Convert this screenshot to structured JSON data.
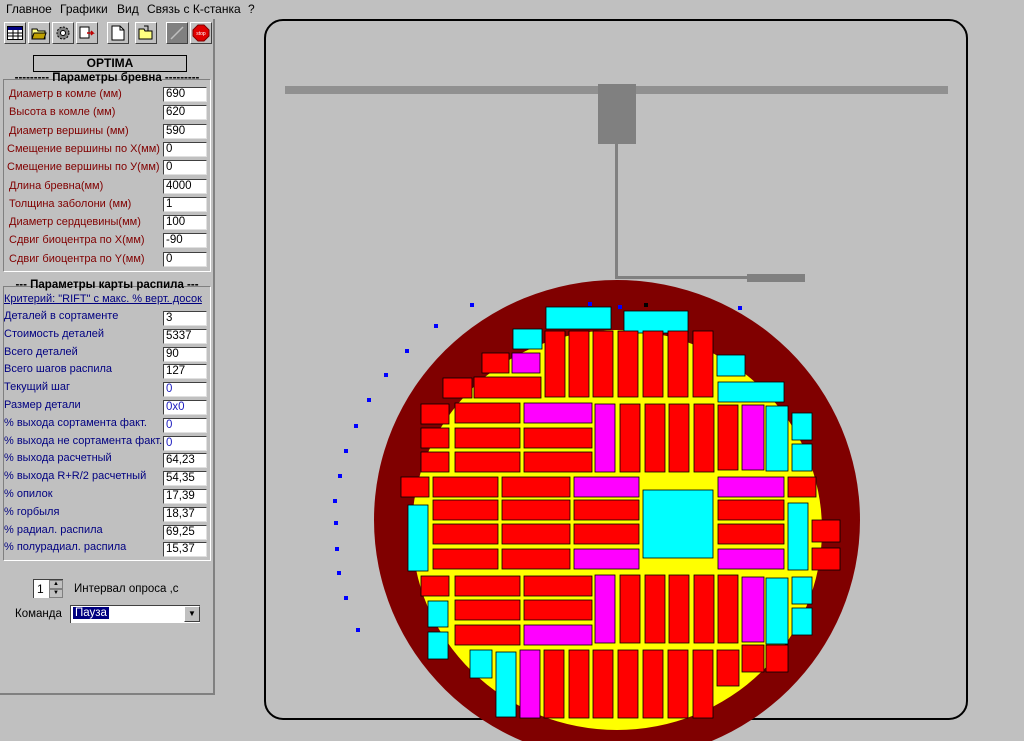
{
  "menu": [
    "Главное",
    "Графики",
    "Вид",
    "Связь с К-станка",
    "?"
  ],
  "toolbar": {
    "icons": [
      "table-icon",
      "open-folder-icon",
      "gear-icon",
      "export-icon",
      "new-file-icon",
      "open-file-icon",
      "line-tool-icon",
      "stop-icon"
    ],
    "stop_label": "stop"
  },
  "optima_label": "OPTIMA",
  "log_params": {
    "title": "--------- Параметры бревна ---------",
    "fields": [
      {
        "label": "Диаметр в комле (мм)",
        "value": "690"
      },
      {
        "label": "Высота в комле (мм)",
        "value": "620"
      },
      {
        "label": "Диаметр вершины (мм)",
        "value": "590"
      },
      {
        "label": "Смещение вершины по X(мм)",
        "value": "0"
      },
      {
        "label": "Смещение вершины по У(мм)",
        "value": "0"
      },
      {
        "label": "Длина  бревна(мм)",
        "value": "4000"
      },
      {
        "label": "Толщина заболони (мм)",
        "value": "1"
      },
      {
        "label": "Диаметр сердцевины(мм)",
        "value": "100"
      },
      {
        "label": "Сдвиг биоцентра по X(мм)",
        "value": "-90"
      },
      {
        "label": "Сдвиг биоцентра по Y(мм)",
        "value": "0"
      }
    ]
  },
  "cut_params": {
    "title": "--- Параметры карты распила ---",
    "criterion": "Критерий: \"RIFT\" с макс. % верт. досок",
    "fields": [
      {
        "label": "Деталей в сортаменте",
        "value": "3",
        "style": "blue",
        "disabled": false
      },
      {
        "label": "Стоимость деталей",
        "value": "5337",
        "style": "blue",
        "disabled": false
      },
      {
        "label": "Всего деталей",
        "value": "90",
        "style": "blue",
        "disabled": false
      },
      {
        "label": "Всего шагов распила",
        "value": "127",
        "style": "blue",
        "disabled": false
      },
      {
        "label": "Текущий шаг",
        "value": "0",
        "style": "blue",
        "disabled": true
      },
      {
        "label": "Размер детали",
        "value": "0x0",
        "style": "blue",
        "disabled": true
      },
      {
        "label": "% выхода сортамента факт.",
        "value": "0",
        "style": "blue",
        "disabled": true
      },
      {
        "label": "% выхода не сортамента факт.",
        "value": "0",
        "style": "blue",
        "disabled": true
      },
      {
        "label": "% выхода расчетный",
        "value": "64,23",
        "style": "blue",
        "disabled": false
      },
      {
        "label": "% выхода R+R/2 расчетный",
        "value": "54,35",
        "style": "blue",
        "disabled": false
      },
      {
        "label": "%  опилок",
        "value": "17,39",
        "style": "blue",
        "disabled": false
      },
      {
        "label": "%  горбыля",
        "value": "18,37",
        "style": "blue",
        "disabled": false
      },
      {
        "label": "%  радиал. распила",
        "value": "69,25",
        "style": "blue",
        "disabled": false
      },
      {
        "label": "%  полурадиал. распила",
        "value": "15,37",
        "style": "blue",
        "disabled": false
      }
    ]
  },
  "interval": {
    "value": "1",
    "label": "Интервал  опроса ,с"
  },
  "command": {
    "label": "Команда",
    "value": "Пауза"
  },
  "colors": {
    "board": "#ff0000",
    "cyan": "#00ffff",
    "magenta": "#ff00ff",
    "log_bark": "#800000",
    "log_wood": "#ffff00",
    "marker": "#0000ff"
  }
}
